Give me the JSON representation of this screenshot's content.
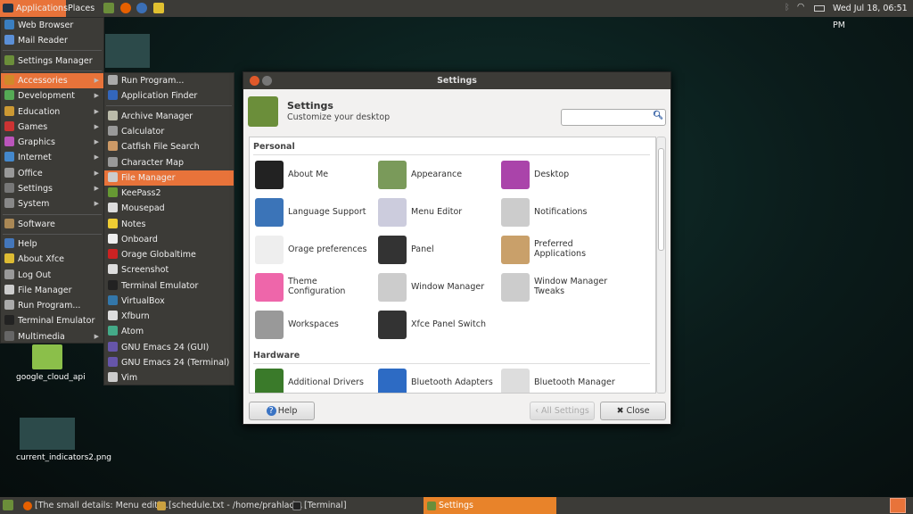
{
  "top_panel": {
    "applications": "Applications",
    "places": "Places",
    "clock": "Wed Jul 18, 06:51 PM",
    "launchers": [
      "settings-manager-icon",
      "firefox-icon",
      "thunderbird-icon",
      "teapot-icon"
    ],
    "tray": [
      "bluetooth-icon",
      "wifi-icon",
      "battery-icon"
    ]
  },
  "main_menu": {
    "items": [
      {
        "label": "Web Browser",
        "icon": "#3a7fc1"
      },
      {
        "label": "Mail Reader",
        "icon": "#5b8fd6"
      },
      {
        "label": "Settings Manager",
        "icon": "#6b8e3a"
      },
      {
        "label": "Accessories",
        "icon": "#d08a2a",
        "sub": true,
        "hl": true
      },
      {
        "label": "Development",
        "icon": "#5a5",
        "sub": true
      },
      {
        "label": "Education",
        "icon": "#c93",
        "sub": true
      },
      {
        "label": "Games",
        "icon": "#c33",
        "sub": true
      },
      {
        "label": "Graphics",
        "icon": "#b5b",
        "sub": true
      },
      {
        "label": "Internet",
        "icon": "#48c",
        "sub": true
      },
      {
        "label": "Office",
        "icon": "#999",
        "sub": true
      },
      {
        "label": "Settings",
        "icon": "#777",
        "sub": true
      },
      {
        "label": "System",
        "icon": "#888",
        "sub": true
      },
      {
        "label": "Software",
        "icon": "#a85"
      },
      {
        "label": "Help",
        "icon": "#47b"
      },
      {
        "label": "About Xfce",
        "icon": "#db3"
      },
      {
        "label": "Log Out",
        "icon": "#999"
      },
      {
        "label": "File Manager",
        "icon": "#ccc"
      },
      {
        "label": "Run Program...",
        "icon": "#aaa"
      },
      {
        "label": "Terminal Emulator",
        "icon": "#222"
      },
      {
        "label": "Multimedia",
        "icon": "#666",
        "sub": true
      }
    ]
  },
  "sub_menu": {
    "items": [
      {
        "label": "Run Program...",
        "icon": "#aaa"
      },
      {
        "label": "Application Finder",
        "icon": "#36b"
      },
      {
        "label": "Archive Manager",
        "icon": "#bba"
      },
      {
        "label": "Calculator",
        "icon": "#999"
      },
      {
        "label": "Catfish File Search",
        "icon": "#c96"
      },
      {
        "label": "Character Map",
        "icon": "#999"
      },
      {
        "label": "File Manager",
        "icon": "#ccc",
        "hl": true
      },
      {
        "label": "KeePass2",
        "icon": "#693"
      },
      {
        "label": "Mousepad",
        "icon": "#ddd"
      },
      {
        "label": "Notes",
        "icon": "#ec3"
      },
      {
        "label": "Onboard",
        "icon": "#eee"
      },
      {
        "label": "Orage Globaltime",
        "icon": "#c22"
      },
      {
        "label": "Screenshot",
        "icon": "#ddd"
      },
      {
        "label": "Terminal Emulator",
        "icon": "#222"
      },
      {
        "label": "VirtualBox",
        "icon": "#37a"
      },
      {
        "label": "Xfburn",
        "icon": "#ddd"
      },
      {
        "label": "Atom",
        "icon": "#4a8"
      },
      {
        "label": "GNU Emacs 24 (GUI)",
        "icon": "#65a"
      },
      {
        "label": "GNU Emacs 24 (Terminal)",
        "icon": "#65a"
      },
      {
        "label": "Vim",
        "icon": "#ccc"
      }
    ]
  },
  "settings": {
    "title": "Settings",
    "heading": "Settings",
    "subtitle": "Customize your desktop",
    "search_value": "",
    "categories": [
      {
        "name": "Personal",
        "items": [
          {
            "label": "About Me",
            "icon": "#222"
          },
          {
            "label": "Appearance",
            "icon": "#7a9a5a"
          },
          {
            "label": "Desktop",
            "icon": "#a4a"
          },
          {
            "label": "Language Support",
            "icon": "#3b74b8"
          },
          {
            "label": "Menu Editor",
            "icon": "#ccd"
          },
          {
            "label": "Notifications",
            "icon": "#ccc"
          },
          {
            "label": "Orage preferences",
            "icon": "#eee"
          },
          {
            "label": "Panel",
            "icon": "#333"
          },
          {
            "label": "Preferred Applications",
            "icon": "#c9a06a"
          },
          {
            "label": "Theme Configuration",
            "icon": "#e6a"
          },
          {
            "label": "Window Manager",
            "icon": "#ccc"
          },
          {
            "label": "Window Manager Tweaks",
            "icon": "#ccc"
          },
          {
            "label": "Workspaces",
            "icon": "#999"
          },
          {
            "label": "Xfce Panel Switch",
            "icon": "#333"
          }
        ]
      },
      {
        "name": "Hardware",
        "items": [
          {
            "label": "Additional Drivers",
            "icon": "#3a7a2a"
          },
          {
            "label": "Bluetooth Adapters",
            "icon": "#2d6bc4"
          },
          {
            "label": "Bluetooth Manager",
            "icon": "#ddd"
          }
        ]
      }
    ],
    "help": "Help",
    "all_settings": "All Settings",
    "close": "Close"
  },
  "desktop": {
    "icons": [
      "google_cloud_api",
      "current_indicators2.png"
    ]
  },
  "taskbar": {
    "tasks": [
      "[The small details: Menu editi...",
      "[schedule.txt - /home/prahlad...",
      "[Terminal]",
      "Settings"
    ]
  }
}
